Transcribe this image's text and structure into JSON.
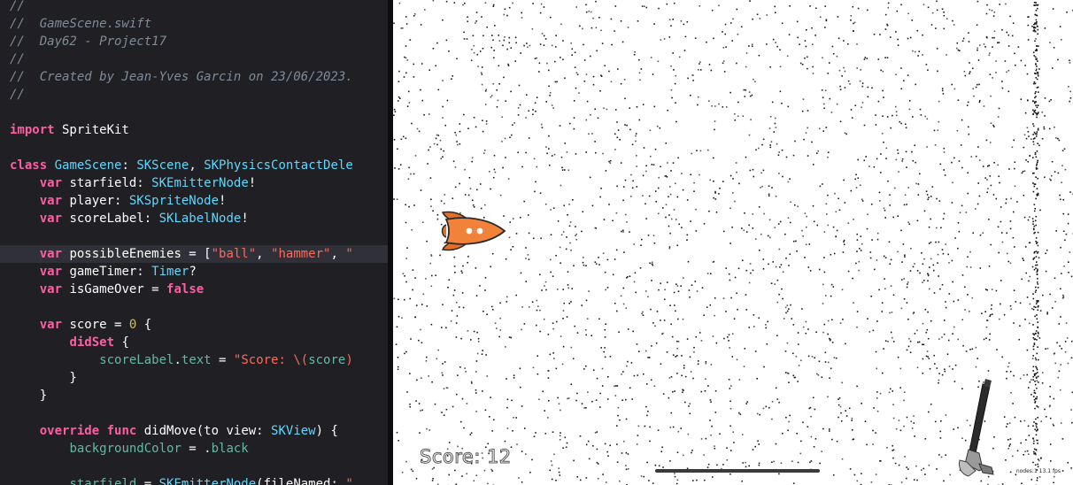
{
  "editor": {
    "filename_comment": "//  GameScene.swift",
    "lines": [
      {
        "hl": false,
        "tokens": [
          {
            "c": "comment",
            "t": "//"
          }
        ]
      },
      {
        "hl": false,
        "tokens": [
          {
            "c": "comment",
            "t": "//  GameScene.swift"
          }
        ]
      },
      {
        "hl": false,
        "tokens": [
          {
            "c": "comment",
            "t": "//  Day62 - Project17"
          }
        ]
      },
      {
        "hl": false,
        "tokens": [
          {
            "c": "comment",
            "t": "//"
          }
        ]
      },
      {
        "hl": false,
        "tokens": [
          {
            "c": "comment",
            "t": "//  Created by Jean-Yves Garcin on 23/06/2023."
          }
        ]
      },
      {
        "hl": false,
        "tokens": [
          {
            "c": "comment",
            "t": "//"
          }
        ]
      },
      {
        "hl": false,
        "tokens": []
      },
      {
        "hl": false,
        "tokens": [
          {
            "c": "keyword",
            "t": "import"
          },
          {
            "c": "plain",
            "t": " SpriteKit"
          }
        ]
      },
      {
        "hl": false,
        "tokens": []
      },
      {
        "hl": false,
        "tokens": [
          {
            "c": "keyword",
            "t": "class"
          },
          {
            "c": "plain",
            "t": " "
          },
          {
            "c": "type",
            "t": "GameScene"
          },
          {
            "c": "plain",
            "t": ": "
          },
          {
            "c": "type",
            "t": "SKScene"
          },
          {
            "c": "plain",
            "t": ", "
          },
          {
            "c": "type",
            "t": "SKPhysicsContactDele"
          }
        ]
      },
      {
        "hl": false,
        "tokens": [
          {
            "c": "plain",
            "t": "    "
          },
          {
            "c": "keyword",
            "t": "var"
          },
          {
            "c": "plain",
            "t": " starfield: "
          },
          {
            "c": "type",
            "t": "SKEmitterNode"
          },
          {
            "c": "plain",
            "t": "!"
          }
        ]
      },
      {
        "hl": false,
        "tokens": [
          {
            "c": "plain",
            "t": "    "
          },
          {
            "c": "keyword",
            "t": "var"
          },
          {
            "c": "plain",
            "t": " player: "
          },
          {
            "c": "type",
            "t": "SKSpriteNode"
          },
          {
            "c": "plain",
            "t": "!"
          }
        ]
      },
      {
        "hl": false,
        "tokens": [
          {
            "c": "plain",
            "t": "    "
          },
          {
            "c": "keyword",
            "t": "var"
          },
          {
            "c": "plain",
            "t": " scoreLabel: "
          },
          {
            "c": "type",
            "t": "SKLabelNode"
          },
          {
            "c": "plain",
            "t": "!"
          }
        ]
      },
      {
        "hl": false,
        "tokens": []
      },
      {
        "hl": true,
        "tokens": [
          {
            "c": "plain",
            "t": "    "
          },
          {
            "c": "keyword",
            "t": "var"
          },
          {
            "c": "plain",
            "t": " possibleEnemies = ["
          },
          {
            "c": "string",
            "t": "\"ball\""
          },
          {
            "c": "plain",
            "t": ", "
          },
          {
            "c": "string",
            "t": "\"hammer\""
          },
          {
            "c": "plain",
            "t": ", "
          },
          {
            "c": "string",
            "t": "\""
          }
        ]
      },
      {
        "hl": false,
        "tokens": [
          {
            "c": "plain",
            "t": "    "
          },
          {
            "c": "keyword",
            "t": "var"
          },
          {
            "c": "plain",
            "t": " gameTimer: "
          },
          {
            "c": "type",
            "t": "Timer"
          },
          {
            "c": "plain",
            "t": "?"
          }
        ]
      },
      {
        "hl": false,
        "tokens": [
          {
            "c": "plain",
            "t": "    "
          },
          {
            "c": "keyword",
            "t": "var"
          },
          {
            "c": "plain",
            "t": " isGameOver = "
          },
          {
            "c": "keyword",
            "t": "false"
          }
        ]
      },
      {
        "hl": false,
        "tokens": []
      },
      {
        "hl": false,
        "tokens": [
          {
            "c": "plain",
            "t": "    "
          },
          {
            "c": "keyword",
            "t": "var"
          },
          {
            "c": "plain",
            "t": " score = "
          },
          {
            "c": "number",
            "t": "0"
          },
          {
            "c": "plain",
            "t": " {"
          }
        ]
      },
      {
        "hl": false,
        "tokens": [
          {
            "c": "plain",
            "t": "        "
          },
          {
            "c": "keyword",
            "t": "didSet"
          },
          {
            "c": "plain",
            "t": " {"
          }
        ]
      },
      {
        "hl": false,
        "tokens": [
          {
            "c": "plain",
            "t": "            "
          },
          {
            "c": "ident",
            "t": "scoreLabel"
          },
          {
            "c": "plain",
            "t": "."
          },
          {
            "c": "ident",
            "t": "text"
          },
          {
            "c": "plain",
            "t": " = "
          },
          {
            "c": "string",
            "t": "\"Score: \\("
          },
          {
            "c": "ident",
            "t": "score"
          },
          {
            "c": "string",
            "t": ")"
          }
        ]
      },
      {
        "hl": false,
        "tokens": [
          {
            "c": "plain",
            "t": "        }"
          }
        ]
      },
      {
        "hl": false,
        "tokens": [
          {
            "c": "plain",
            "t": "    }"
          }
        ]
      },
      {
        "hl": false,
        "tokens": []
      },
      {
        "hl": false,
        "tokens": [
          {
            "c": "plain",
            "t": "    "
          },
          {
            "c": "keyword",
            "t": "override"
          },
          {
            "c": "plain",
            "t": " "
          },
          {
            "c": "keyword",
            "t": "func"
          },
          {
            "c": "plain",
            "t": " didMove(to view: "
          },
          {
            "c": "type",
            "t": "SKView"
          },
          {
            "c": "plain",
            "t": ") {"
          }
        ]
      },
      {
        "hl": false,
        "tokens": [
          {
            "c": "plain",
            "t": "        "
          },
          {
            "c": "ident",
            "t": "backgroundColor"
          },
          {
            "c": "plain",
            "t": " = ."
          },
          {
            "c": "ident",
            "t": "black"
          }
        ]
      },
      {
        "hl": false,
        "tokens": []
      },
      {
        "hl": false,
        "tokens": [
          {
            "c": "plain",
            "t": "        "
          },
          {
            "c": "ident",
            "t": "starfield"
          },
          {
            "c": "plain",
            "t": " = "
          },
          {
            "c": "type",
            "t": "SKEmitterNode"
          },
          {
            "c": "plain",
            "t": "(fileNamed: "
          },
          {
            "c": "string",
            "t": "\""
          }
        ]
      }
    ]
  },
  "game": {
    "score_text": "Score: 12",
    "stats_text": "nodes:1  13.1 fps",
    "sprites": {
      "player": "rocket-icon",
      "enemy": "hammer-icon"
    }
  },
  "colors": {
    "editor_bg": "#1f1f24",
    "highlight_line": "#2f3038",
    "comment": "#7f8c98",
    "keyword": "#fc5fa3",
    "type": "#5dd8ff",
    "string": "#fc6a5d",
    "number": "#d0bf69",
    "identifier": "#67b7a4",
    "rocket_orange": "#f2823a",
    "game_bg": "#ffffff"
  }
}
